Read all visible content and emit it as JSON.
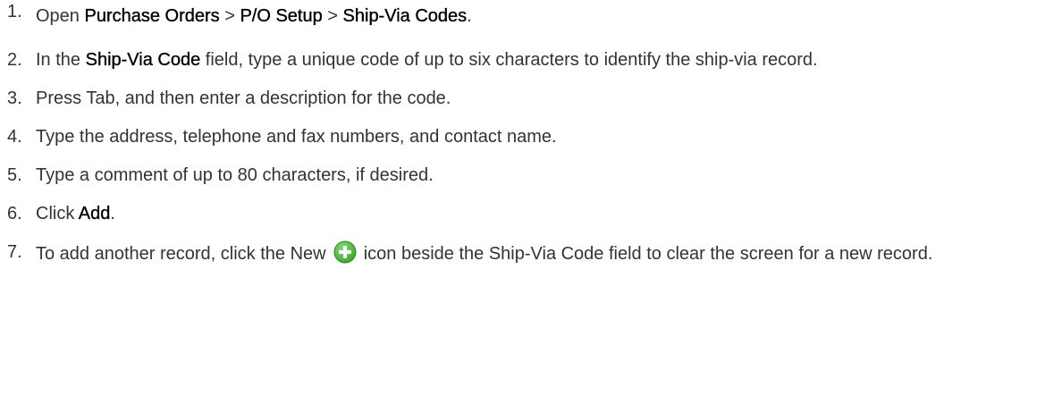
{
  "steps": [
    {
      "number": "1.",
      "parts": [
        {
          "text": "Open ",
          "bold": false
        },
        {
          "text": "Purchase Orders",
          "bold": true
        },
        {
          "text": " > ",
          "bold": false
        },
        {
          "text": "P/O Setup",
          "bold": true
        },
        {
          "text": " > ",
          "bold": false
        },
        {
          "text": "Ship-Via Codes",
          "bold": true
        },
        {
          "text": ".",
          "bold": false
        }
      ]
    },
    {
      "number": "2.",
      "parts": [
        {
          "text": "In the ",
          "bold": false
        },
        {
          "text": "Ship-Via Code",
          "bold": true
        },
        {
          "text": " field, type a unique code of up to six characters to identify the ship-via record.",
          "bold": false
        }
      ]
    },
    {
      "number": "3.",
      "parts": [
        {
          "text": "Press Tab, and then enter a description for the code.",
          "bold": false
        }
      ]
    },
    {
      "number": "4.",
      "parts": [
        {
          "text": "Type the address, telephone and fax numbers, and contact name.",
          "bold": false
        }
      ]
    },
    {
      "number": "5.",
      "parts": [
        {
          "text": "Type a comment of up to 80 characters, if desired.",
          "bold": false
        }
      ]
    },
    {
      "number": "6.",
      "parts": [
        {
          "text": "Click ",
          "bold": false
        },
        {
          "text": "Add",
          "bold": true
        },
        {
          "text": ".",
          "bold": false
        }
      ]
    },
    {
      "number": "7.",
      "parts": [
        {
          "text": "To add another record, click the New ",
          "bold": false
        },
        {
          "text": " icon beside the Ship-Via Code field to clear the screen for a new record.",
          "bold": false
        }
      ]
    }
  ],
  "icons": {
    "new_icon": "plus-circle-icon",
    "new_icon_color": "#3aa829",
    "new_icon_highlight": "#8fd97a"
  },
  "colors": {
    "body_text": "#333333",
    "emphasis_text": "#000000",
    "background": "#ffffff"
  }
}
